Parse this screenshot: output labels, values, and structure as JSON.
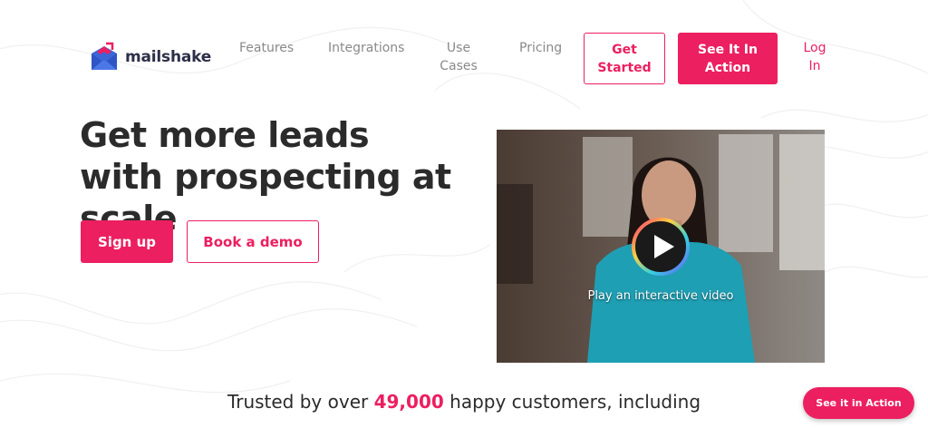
{
  "brand": {
    "name": "mailshake",
    "accent": "#ec1f60"
  },
  "nav": {
    "features": "Features",
    "integrations": "Integrations",
    "use_cases": "Use Cases",
    "pricing": "Pricing",
    "get_started": "Get Started",
    "see_it_in_action": "See It In Action",
    "log_in": "Log In"
  },
  "hero": {
    "title": "Get more leads with prospecting at scale",
    "signup_label": "Sign up",
    "demo_label": "Book a demo"
  },
  "video": {
    "caption": "Play an interactive video",
    "icon": "play-icon"
  },
  "trusted": {
    "prefix": "Trusted by over",
    "count": "49,000",
    "suffix": "happy customers, including"
  },
  "floating": {
    "label": "See it in Action"
  }
}
